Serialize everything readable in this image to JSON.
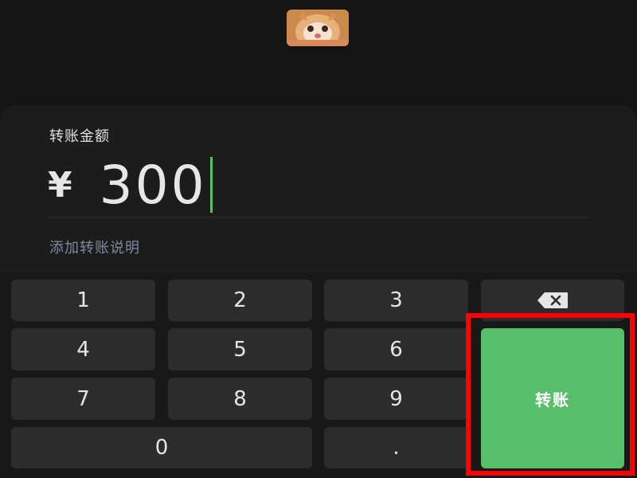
{
  "header": {
    "avatar_icon": "cat-photo-avatar"
  },
  "amount": {
    "label": "转账金额",
    "currency": "¥",
    "value": "300"
  },
  "note": {
    "link_label": "添加转账说明"
  },
  "keypad": {
    "keys": [
      "1",
      "2",
      "3",
      "4",
      "5",
      "6",
      "7",
      "8",
      "9",
      "0",
      "."
    ],
    "backspace_icon": "backspace-icon",
    "transfer_label": "转账"
  },
  "colors": {
    "accent": "#57be6a",
    "background": "#141414",
    "key_bg": "#2c2c2c",
    "highlight": "#ff0000"
  }
}
